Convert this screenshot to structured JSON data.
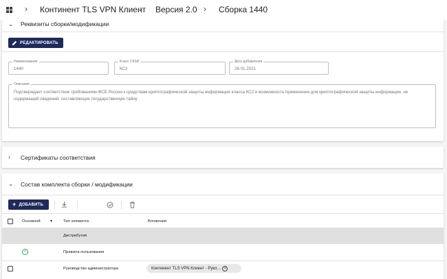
{
  "breadcrumb": {
    "items": [
      "Континент TLS VPN Клиент",
      "Версия 2.0",
      "Сборка 1440"
    ],
    "separator": "›"
  },
  "details_section": {
    "title": "Реквизиты сборки/модификации",
    "edit_button": "РЕДАКТИРОВАТЬ",
    "fields": {
      "name": {
        "label": "Наименование",
        "value": "1440"
      },
      "class": {
        "label": "Класс СКЗИ",
        "value": "КС2"
      },
      "date": {
        "label": "Дата добавления",
        "value": "26.01.2021"
      },
      "description": {
        "label": "Описание",
        "value": "Подтверждает соответствие требованиям ФСБ России к средствам криптографической защиты информации класса КС2 и возможность применения для криптографической защиты информации, не содержащей сведений, составляющих государственную тайну"
      }
    }
  },
  "certificates_section": {
    "title": "Сертификаты соответствия"
  },
  "kit_section": {
    "title": "Состав комплекта сборки / модификации",
    "add_button": "ДОБАВИТЬ",
    "toolbar_icons": [
      "download-icon",
      "check-circle-icon",
      "trash-icon"
    ],
    "columns": {
      "main": "Основной",
      "type": "Тип элемента",
      "attachments": "Вложения"
    },
    "rows": [
      {
        "main": false,
        "type": "Дистрибутив",
        "attachment": "",
        "highlighted": true
      },
      {
        "main": true,
        "type": "Правила пользования",
        "attachment": "",
        "highlighted": false
      },
      {
        "main": false,
        "type": "Руководство администратора",
        "attachment": "Континент TLS VPN Клиент - Руко...",
        "highlighted": false
      }
    ]
  },
  "colors": {
    "primary_button": "#1f2a5a",
    "success": "#2e9d55",
    "highlight_row": "#e0e0e0"
  }
}
